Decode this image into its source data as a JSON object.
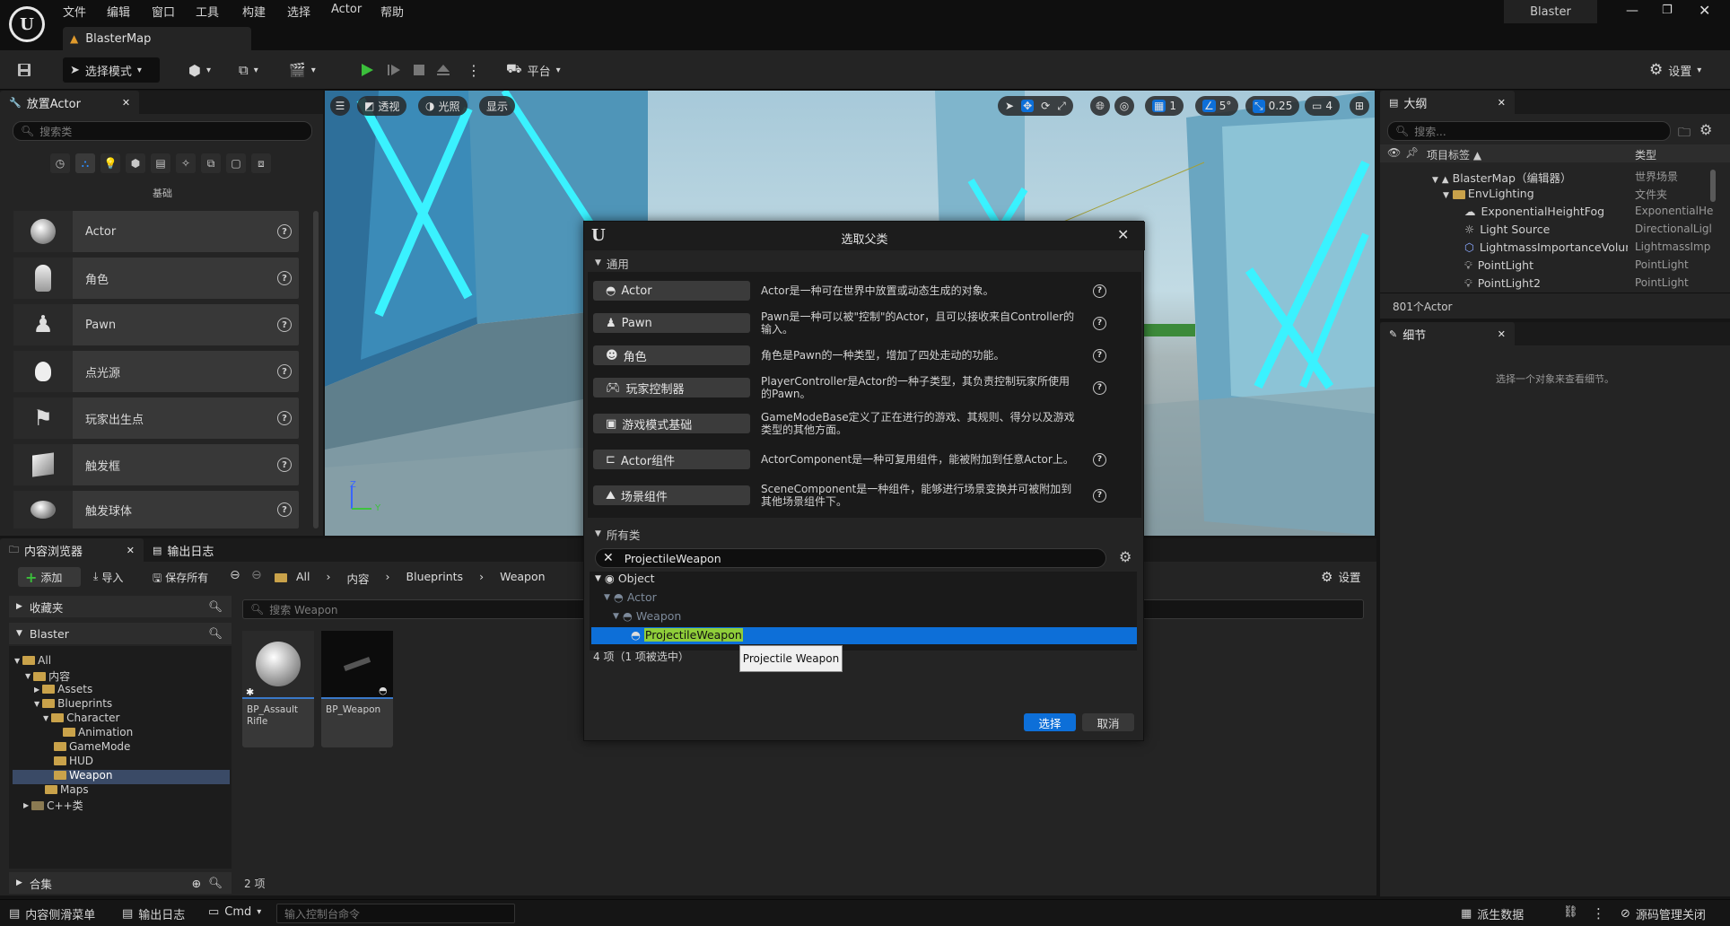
{
  "app": {
    "project_name": "Blaster",
    "map_tab": "BlasterMap",
    "menu": [
      "文件",
      "编辑",
      "窗口",
      "工具",
      "构建",
      "选择",
      "Actor",
      "帮助"
    ]
  },
  "toolbar": {
    "mode_label": "选择模式",
    "platform_label": "平台",
    "settings_label": "设置"
  },
  "place_actors": {
    "tab_label": "放置Actor",
    "search_placeholder": "搜索类",
    "category_label": "基础",
    "items": [
      {
        "label": "Actor"
      },
      {
        "label": "角色"
      },
      {
        "label": "Pawn"
      },
      {
        "label": "点光源"
      },
      {
        "label": "玩家出生点"
      },
      {
        "label": "触发框"
      },
      {
        "label": "触发球体"
      }
    ]
  },
  "viewport": {
    "perspective_label": "透视",
    "lit_label": "光照",
    "show_label": "显示",
    "grid_value": "1",
    "angle_value": "5°",
    "scale_value": "0.25",
    "camera_speed": "4",
    "axis_z": "Z",
    "axis_y": "Y"
  },
  "outliner": {
    "tab_label": "大纲",
    "search_placeholder": "搜索...",
    "col_label": "项目标签 ▲",
    "col_type": "类型",
    "rows": [
      {
        "label": "BlasterMap（编辑器）",
        "type": "世界场景"
      },
      {
        "label": "EnvLighting",
        "type": "文件夹"
      },
      {
        "label": "ExponentialHeightFog",
        "type": "ExponentialHe"
      },
      {
        "label": "Light Source",
        "type": "DirectionalLigl"
      },
      {
        "label": "LightmassImportanceVolum",
        "type": "LightmassImp"
      },
      {
        "label": "PointLight",
        "type": "PointLight"
      },
      {
        "label": "PointLight2",
        "type": "PointLight"
      }
    ],
    "count_label": "801个Actor"
  },
  "details": {
    "tab_label": "细节",
    "empty_hint": "选择一个对象来查看细节。"
  },
  "content_browser": {
    "tab_label": "内容浏览器",
    "log_tab_label": "输出日志",
    "add_label": "添加",
    "import_label": "导入",
    "save_all_label": "保存所有",
    "breadcrumb": [
      "All",
      "内容",
      "Blueprints",
      "Weapon"
    ],
    "settings_label": "设置",
    "favorites_label": "收藏夹",
    "project_label": "Blaster",
    "tree": [
      {
        "label": "All",
        "depth": 0
      },
      {
        "label": "内容",
        "depth": 1
      },
      {
        "label": "Assets",
        "depth": 2
      },
      {
        "label": "Blueprints",
        "depth": 2
      },
      {
        "label": "Character",
        "depth": 3
      },
      {
        "label": "Animation",
        "depth": 4
      },
      {
        "label": "GameMode",
        "depth": 3
      },
      {
        "label": "HUD",
        "depth": 3
      },
      {
        "label": "Weapon",
        "depth": 3
      },
      {
        "label": "Maps",
        "depth": 2
      },
      {
        "label": "C++类",
        "depth": 1
      }
    ],
    "search_placeholder": "搜索 Weapon",
    "assets": [
      {
        "label": "BP_Assault Rifle"
      },
      {
        "label": "BP_Weapon"
      }
    ],
    "item_count": "2 项",
    "collections_label": "合集"
  },
  "dialog": {
    "title": "选取父类",
    "common_section": "通用",
    "common": [
      {
        "label": "Actor",
        "desc": "Actor是一种可在世界中放置或动态生成的对象。"
      },
      {
        "label": "Pawn",
        "desc": "Pawn是一种可以被\"控制\"的Actor，且可以接收来自Controller的输入。"
      },
      {
        "label": "角色",
        "desc": "角色是Pawn的一种类型，增加了四处走动的功能。"
      },
      {
        "label": "玩家控制器",
        "desc": "PlayerController是Actor的一种子类型，其负责控制玩家所使用的Pawn。"
      },
      {
        "label": "游戏模式基础",
        "desc": "GameModeBase定义了正在进行的游戏、其规则、得分以及游戏类型的其他方面。"
      },
      {
        "label": "Actor组件",
        "desc": "ActorComponent是一种可复用组件，能被附加到任意Actor上。"
      },
      {
        "label": "场景组件",
        "desc": "SceneComponent是一种组件，能够进行场景变换并可被附加到其他场景组件下。"
      }
    ],
    "all_classes_section": "所有类",
    "search_value": "ProjectileWeapon",
    "class_tree": [
      {
        "label": "Object"
      },
      {
        "label": "Actor"
      },
      {
        "label": "Weapon"
      },
      {
        "label": "ProjectileWeapon"
      }
    ],
    "count_label": "4 项（1 项被选中）",
    "tooltip": "Projectile Weapon",
    "select_label": "选择",
    "cancel_label": "取消"
  },
  "statusbar": {
    "drawer_label": "内容侧滑菜单",
    "log_label": "输出日志",
    "cmd_label": "Cmd",
    "console_placeholder": "输入控制台命令",
    "derived_data_label": "派生数据",
    "source_control_label": "源码管理关闭"
  },
  "colors": {
    "accent": "#0d6fd8",
    "selection": "#0d6fd8",
    "highlight_text": "#8fce3a",
    "play_green": "#3bbf3b"
  }
}
